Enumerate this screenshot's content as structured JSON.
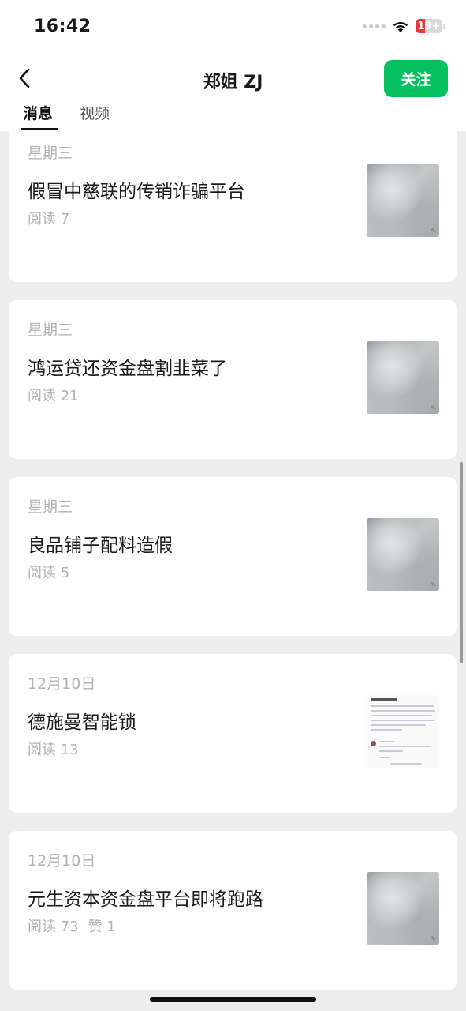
{
  "status_bar": {
    "time": "16:42",
    "battery": "19+"
  },
  "header": {
    "title": "郑姐 ZJ",
    "follow_label": "关注"
  },
  "tabs": [
    {
      "label": "消息",
      "active": true
    },
    {
      "label": "视频",
      "active": false
    }
  ],
  "posts": [
    {
      "date": "星期三",
      "title": "假冒中慈联的传销诈骗平台",
      "reads": "阅读 7",
      "likes": "",
      "thumb": "cloud-photo"
    },
    {
      "date": "星期三",
      "title": "鸿运贷还资金盘割韭菜了",
      "reads": "阅读 21",
      "likes": "",
      "thumb": "cloud-photo"
    },
    {
      "date": "星期三",
      "title": "良品铺子配料造假",
      "reads": "阅读 5",
      "likes": "",
      "thumb": "cloud-photo"
    },
    {
      "date": "12月10日",
      "title": "德施曼智能锁",
      "reads": "阅读 13",
      "likes": "",
      "thumb": "document-screenshot"
    },
    {
      "date": "12月10日",
      "title": "元生资本资金盘平台即将跑路",
      "reads": "阅读 73",
      "likes": "赞 1",
      "thumb": "cloud-photo"
    }
  ],
  "colors": {
    "accent": "#07c160",
    "muted_text": "#b2b2b2",
    "background": "#ededed"
  },
  "icons": {
    "back": "chevron-left-icon",
    "wifi": "wifi-icon",
    "signal": "signal-dots-icon",
    "battery": "battery-icon"
  }
}
